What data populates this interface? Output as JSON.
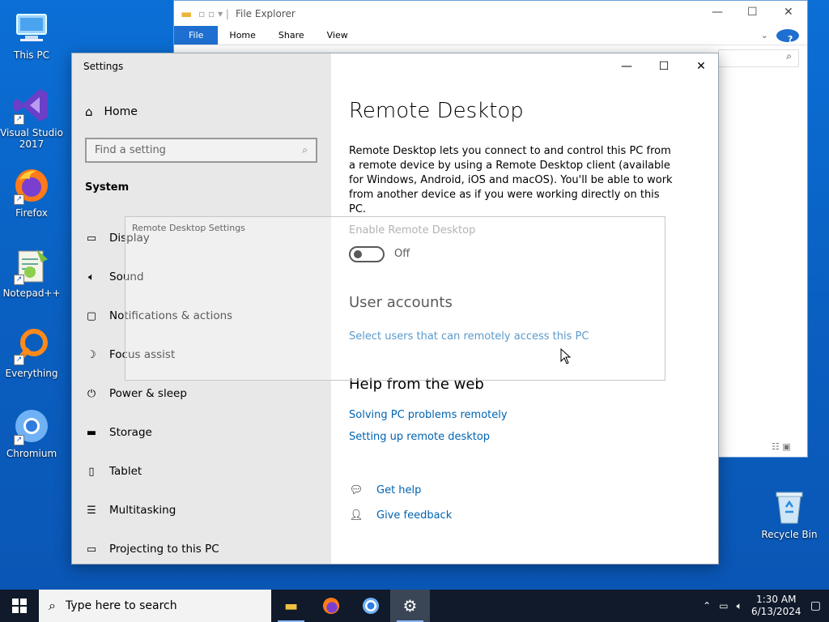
{
  "desktop": {
    "icons": [
      {
        "label": "This PC",
        "icon": "computer-icon"
      },
      {
        "label": "Visual Studio 2017",
        "icon": "visual-studio-icon"
      },
      {
        "label": "Firefox",
        "icon": "firefox-icon"
      },
      {
        "label": "Notepad++",
        "icon": "notepadpp-icon"
      },
      {
        "label": "Everything",
        "icon": "everything-icon"
      },
      {
        "label": "Chromium",
        "icon": "chromium-icon"
      }
    ],
    "recycle_bin": "Recycle Bin"
  },
  "explorer": {
    "title": "File Explorer",
    "tabs": [
      "File",
      "Home",
      "Share",
      "View"
    ]
  },
  "settings": {
    "window_title": "Settings",
    "home": "Home",
    "search_placeholder": "Find a setting",
    "section": "System",
    "nav": [
      {
        "label": "Display",
        "icon": "display-icon"
      },
      {
        "label": "Sound",
        "icon": "sound-icon"
      },
      {
        "label": "Notifications & actions",
        "icon": "notifications-icon"
      },
      {
        "label": "Focus assist",
        "icon": "focus-assist-icon"
      },
      {
        "label": "Power & sleep",
        "icon": "power-icon"
      },
      {
        "label": "Storage",
        "icon": "storage-icon"
      },
      {
        "label": "Tablet",
        "icon": "tablet-icon"
      },
      {
        "label": "Multitasking",
        "icon": "multitasking-icon"
      },
      {
        "label": "Projecting to this PC",
        "icon": "projecting-icon"
      }
    ],
    "page_title": "Remote Desktop",
    "description": "Remote Desktop lets you connect to and control this PC from a remote device by using a Remote Desktop client (available for Windows, Android, iOS and macOS). You'll be able to work from another device as if you were working directly on this PC.",
    "toggle_label": "Enable Remote Desktop",
    "toggle_state": "Off",
    "user_accounts_heading": "User accounts",
    "user_accounts_link": "Select users that can remotely access this PC",
    "help_heading": "Help from the web",
    "help_links": [
      "Solving PC problems remotely",
      "Setting up remote desktop"
    ],
    "get_help": "Get help",
    "give_feedback": "Give feedback"
  },
  "ghost_window": {
    "title": "Remote Desktop Settings"
  },
  "taskbar": {
    "search_placeholder": "Type here to search",
    "time": "1:30 AM",
    "date": "6/13/2024"
  }
}
